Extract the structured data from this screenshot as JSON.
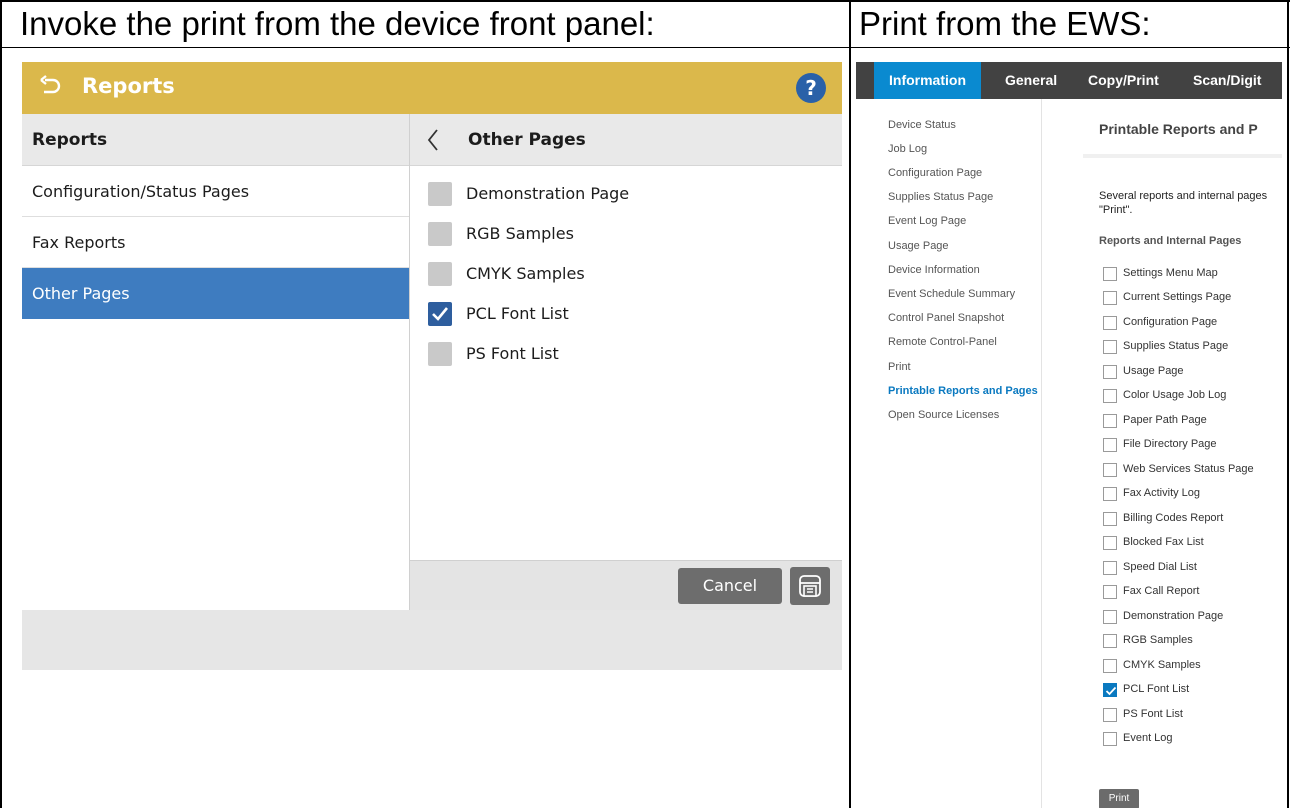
{
  "captions": {
    "left": "Invoke the print from the device front panel:",
    "right": "Print from the EWS:"
  },
  "front_panel": {
    "header_title": "Reports",
    "help_label": "?",
    "left_heading": "Reports",
    "left_items": [
      {
        "label": "Configuration/Status Pages",
        "selected": false
      },
      {
        "label": "Fax Reports",
        "selected": false
      },
      {
        "label": "Other Pages",
        "selected": true
      }
    ],
    "right_heading": "Other Pages",
    "options": [
      {
        "label": "Demonstration Page",
        "checked": false
      },
      {
        "label": "RGB Samples",
        "checked": false
      },
      {
        "label": "CMYK Samples",
        "checked": false
      },
      {
        "label": "PCL Font List",
        "checked": true
      },
      {
        "label": "PS Font List",
        "checked": false
      }
    ],
    "cancel_label": "Cancel",
    "colors": {
      "header": "#dbb84b",
      "selected": "#3e7cc0",
      "checked": "#2e5e9e"
    }
  },
  "ews": {
    "tabs": [
      {
        "label": "Information",
        "active": true
      },
      {
        "label": "General",
        "active": false
      },
      {
        "label": "Copy/Print",
        "active": false
      },
      {
        "label": "Scan/Digit",
        "active": false
      }
    ],
    "sidebar": [
      {
        "label": "Device Status",
        "active": false
      },
      {
        "label": "Job Log",
        "active": false
      },
      {
        "label": "Configuration Page",
        "active": false
      },
      {
        "label": "Supplies Status Page",
        "active": false
      },
      {
        "label": "Event Log Page",
        "active": false
      },
      {
        "label": "Usage Page",
        "active": false
      },
      {
        "label": "Device Information",
        "active": false
      },
      {
        "label": "Event Schedule Summary",
        "active": false
      },
      {
        "label": "Control Panel Snapshot",
        "active": false
      },
      {
        "label": "Remote Control-Panel",
        "active": false
      },
      {
        "label": "Print",
        "active": false
      },
      {
        "label": "Printable Reports and Pages",
        "active": true
      },
      {
        "label": "Open Source Licenses",
        "active": false
      }
    ],
    "page_title": "Printable Reports and P",
    "description_line1": "Several reports and internal pages",
    "description_line2": "\"Print\".",
    "section_title": "Reports and Internal Pages",
    "reports": [
      {
        "label": "Settings Menu Map",
        "checked": false
      },
      {
        "label": "Current Settings Page",
        "checked": false
      },
      {
        "label": "Configuration Page",
        "checked": false
      },
      {
        "label": "Supplies Status Page",
        "checked": false
      },
      {
        "label": "Usage Page",
        "checked": false
      },
      {
        "label": "Color Usage Job Log",
        "checked": false
      },
      {
        "label": "Paper Path Page",
        "checked": false
      },
      {
        "label": "File Directory Page",
        "checked": false
      },
      {
        "label": "Web Services Status Page",
        "checked": false
      },
      {
        "label": "Fax Activity Log",
        "checked": false
      },
      {
        "label": "Billing Codes Report",
        "checked": false
      },
      {
        "label": "Blocked Fax List",
        "checked": false
      },
      {
        "label": "Speed Dial List",
        "checked": false
      },
      {
        "label": "Fax Call Report",
        "checked": false
      },
      {
        "label": "Demonstration Page",
        "checked": false
      },
      {
        "label": "RGB Samples",
        "checked": false
      },
      {
        "label": "CMYK Samples",
        "checked": false
      },
      {
        "label": "PCL Font List",
        "checked": true
      },
      {
        "label": "PS Font List",
        "checked": false
      },
      {
        "label": "Event Log",
        "checked": false
      }
    ],
    "print_label": "Print",
    "colors": {
      "nav": "#424242",
      "active_tab": "#0a8ad0",
      "link_active": "#0a79c0"
    }
  }
}
